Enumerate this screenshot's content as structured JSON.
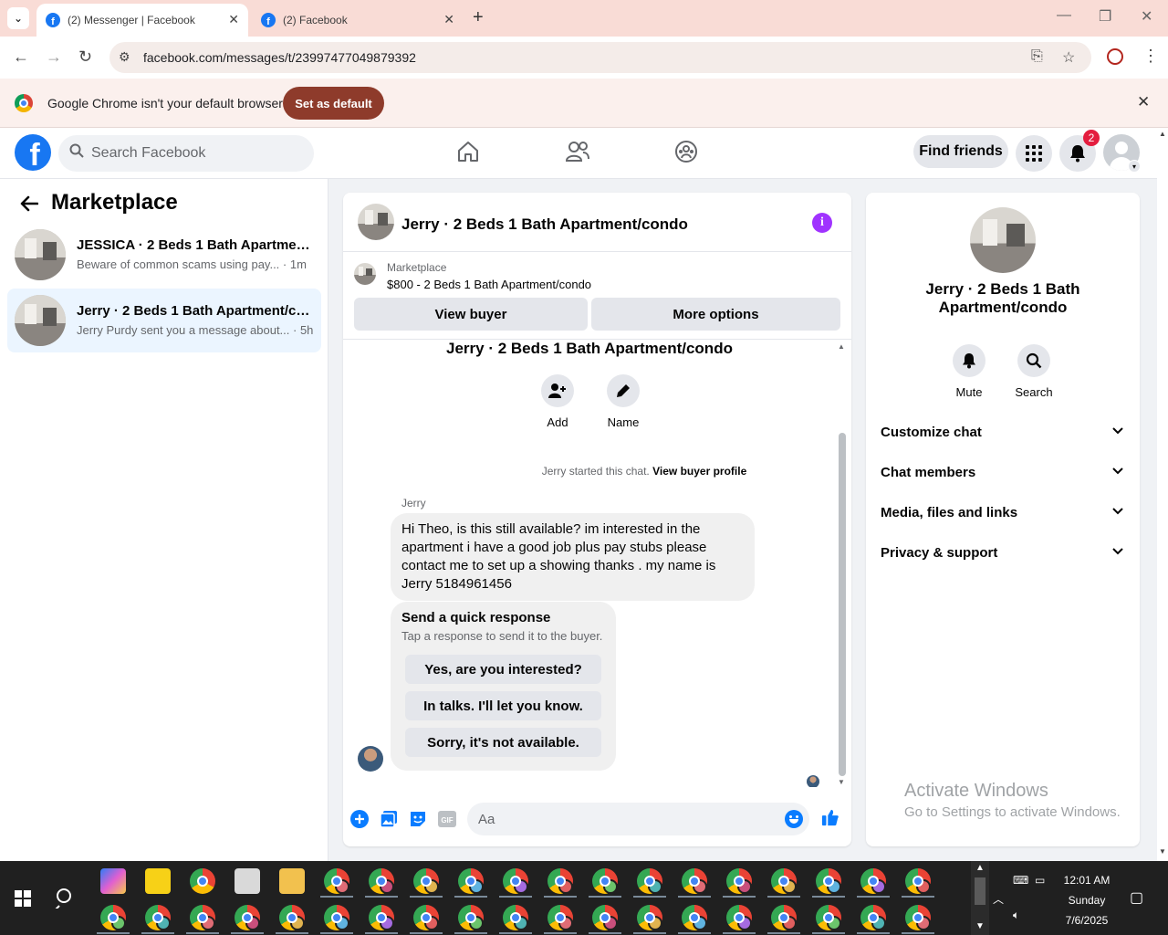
{
  "browser": {
    "tabs": [
      {
        "title": "(2) Messenger | Facebook",
        "active": true
      },
      {
        "title": "(2) Facebook",
        "active": false
      }
    ],
    "url": "facebook.com/messages/t/23997477049879392",
    "infobar": {
      "message": "Google Chrome isn't your default browser",
      "button": "Set as default"
    }
  },
  "header": {
    "search_placeholder": "Search Facebook",
    "find_friends": "Find friends",
    "notification_count": "2"
  },
  "sidebar": {
    "title": "Marketplace",
    "conversations": [
      {
        "name": "JESSICA · 2 Beds 1 Bath Apartment/condo",
        "preview": "Beware of common scams using pay... · 1m",
        "selected": false
      },
      {
        "name": "Jerry · 2 Beds 1 Bath Apartment/condo",
        "preview": "Jerry Purdy sent you a message about... · 5h",
        "selected": true
      }
    ]
  },
  "chat": {
    "title": "Jerry · 2 Beds 1 Bath Apartment/condo",
    "marketplace_label": "Marketplace",
    "listing": "$800 - 2 Beds 1 Bath Apartment/condo",
    "view_buyer": "View buyer",
    "more_options": "More options",
    "thread_title": "Jerry · 2 Beds 1 Bath Apartment/condo",
    "actions": {
      "add": "Add",
      "name": "Name"
    },
    "started_text": "Jerry started this chat.",
    "view_buyer_profile": "View buyer profile",
    "sender": "Jerry",
    "message": "Hi Theo, is this still available? im interested in the apartment i have a good job plus pay stubs please contact me to set up a showing thanks . my name is Jerry 5184961456",
    "quick_response": {
      "title": "Send a quick response",
      "subtitle": "Tap a response to send it to the buyer.",
      "options": [
        "Yes, are you interested?",
        "In talks. I'll let you know.",
        "Sorry, it's not available."
      ]
    },
    "composer_placeholder": "Aa"
  },
  "details": {
    "name": "Jerry · 2 Beds 1 Bath Apartment/condo",
    "mute": "Mute",
    "search": "Search",
    "sections": [
      "Customize chat",
      "Chat members",
      "Media, files and links",
      "Privacy & support"
    ]
  },
  "watermark": {
    "line1": "Activate Windows",
    "line2": "Go to Settings to activate Windows."
  },
  "taskbar": {
    "time": "12:01 AM",
    "day": "Sunday",
    "date": "7/6/2025"
  },
  "colors": {
    "fb_blue": "#1877f2",
    "messenger_blue": "#0a7cff",
    "selected_conv": "#ebf5ff",
    "notif_red": "#e41e3f",
    "info_purple": "#a033ff"
  }
}
